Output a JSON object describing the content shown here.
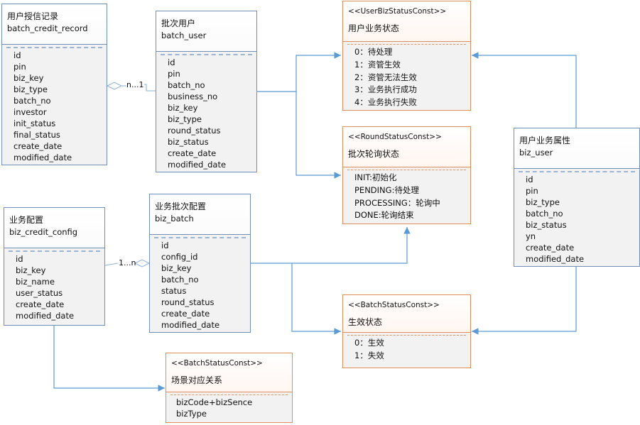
{
  "diagram": {
    "entities": {
      "batch_credit_record": {
        "cn_name": "用户授信记录",
        "en_name": "batch_credit_record",
        "fields": [
          "id",
          "pin",
          "biz_key",
          "biz_type",
          "batch_no",
          "investor",
          "init_status",
          "final_status",
          "create_date",
          "modified_date"
        ]
      },
      "batch_user": {
        "cn_name": "批次用户",
        "en_name": "batch_user",
        "fields": [
          "id",
          "pin",
          "batch_no",
          "business_no",
          "biz_key",
          "biz_type",
          "round_status",
          "biz_status",
          "create_date",
          "modified_date"
        ]
      },
      "biz_user": {
        "cn_name": "用户业务属性",
        "en_name": "biz_user",
        "fields": [
          "id",
          "pin",
          "biz_type",
          "batch_no",
          "biz_status",
          "yn",
          "create_date",
          "modified_date"
        ]
      },
      "biz_credit_config": {
        "cn_name": "业务配置",
        "en_name": "biz_credit_config",
        "fields": [
          "id",
          "biz_key",
          "biz_name",
          "user_status",
          "create_date",
          "modified_date"
        ]
      },
      "biz_batch": {
        "cn_name": "业务批次配置",
        "en_name": "biz_batch",
        "fields": [
          "id",
          "config_id",
          "biz_key",
          "batch_no",
          "status",
          "round_status",
          "create_date",
          "modified_date"
        ]
      }
    },
    "constants": {
      "user_biz_status": {
        "stereotype": "<<UserBizStatusConst>>",
        "title": "用户业务状态",
        "values": [
          "0：待处理",
          "1：资管生效",
          "2：资管无法生效",
          "3：业务执行成功",
          "4：业务执行失败"
        ]
      },
      "round_status": {
        "stereotype": "<<RoundStatusConst>>",
        "title": "批次轮询状态",
        "values": [
          "INIT:初始化",
          "PENDING:待处理",
          "PROCESSING：轮询中",
          "DONE:轮询结束"
        ]
      },
      "batch_status": {
        "stereotype": "<<BatchStatusConst>>",
        "title": "生效状态",
        "values": [
          "0：生效",
          "1：失效"
        ]
      },
      "scene_mapping": {
        "stereotype": "<<BatchStatusConst>>",
        "title": "场景对应关系",
        "values": [
          "bizCode+bizSence",
          "bizType"
        ]
      }
    },
    "relations": {
      "record_to_batch_user": "n...1",
      "config_to_batch": "1...n"
    },
    "colors": {
      "entity_border": "#6f8fb8",
      "const_border": "#e08e5c",
      "connector": "#5b9bd5",
      "aggregation": "#8eb0d8"
    }
  }
}
